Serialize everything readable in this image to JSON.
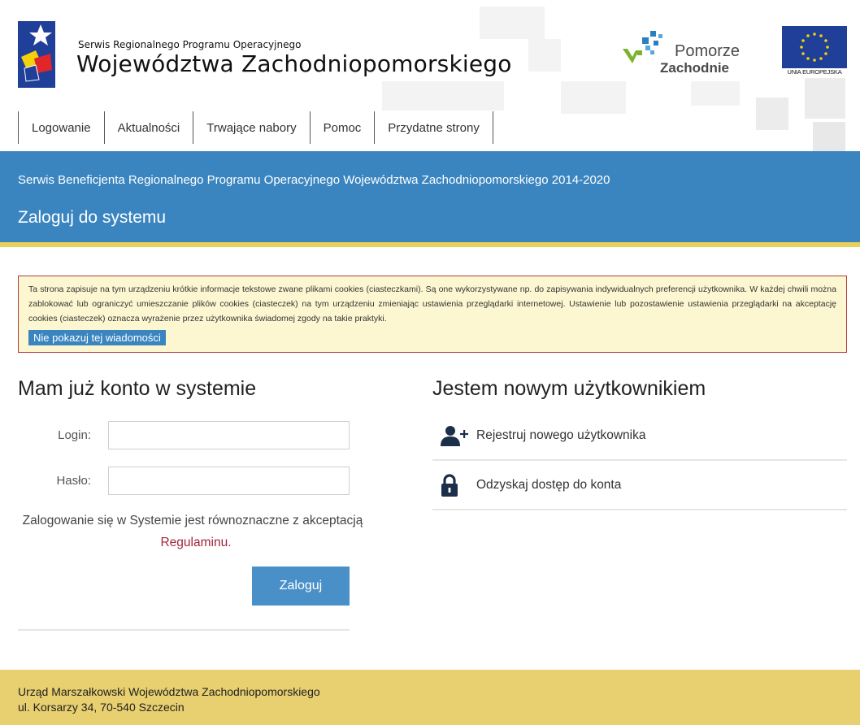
{
  "header": {
    "brand_small": "Serwis Regionalnego Programu Operacyjnego",
    "brand_big": "Województwa Zachodniopomorskiego",
    "pomorze_line1": "Pomorze",
    "pomorze_line2": "Zachodnie",
    "eu_label": "UNIA EUROPEJSKA"
  },
  "nav": {
    "items": [
      {
        "label": "Logowanie"
      },
      {
        "label": "Aktualności"
      },
      {
        "label": "Trwające nabory"
      },
      {
        "label": "Pomoc"
      },
      {
        "label": "Przydatne strony"
      }
    ]
  },
  "band": {
    "subtitle": "Serwis Beneficjenta Regionalnego Programu Operacyjnego Województwa Zachodniopomorskiego 2014-2020",
    "title": "Zaloguj do systemu"
  },
  "cookie": {
    "text": "Ta strona zapisuje na tym urządzeniu krótkie informacje tekstowe zwane plikami cookies (ciasteczkami). Są one wykorzystywane np. do zapisywania indywidualnych preferencji użytkownika. W każdej chwili można zablokować lub ograniczyć umieszczanie plików cookies (ciasteczek) na tym urządzeniu zmieniając ustawienia przeglądarki internetowej. Ustawienie lub pozostawienie ustawienia przeglądarki na akceptację cookies (ciasteczek) oznacza wyrażenie przez użytkownika świadomej zgody na takie praktyki.",
    "dismiss_label": "Nie pokazuj tej wiadomości"
  },
  "login": {
    "title": "Mam już konto w systemie",
    "login_label": "Login:",
    "login_value": "",
    "password_label": "Hasło:",
    "password_value": "",
    "terms_text": "Zalogowanie się w Systemie jest równoznaczne z akceptacją",
    "terms_link": "Regulaminu",
    "terms_end": ".",
    "submit_label": "Zaloguj"
  },
  "new_user": {
    "title": "Jestem nowym użytkownikiem",
    "register_label": "Rejestruj nowego użytkownika",
    "recover_label": "Odzyskaj dostęp do konta"
  },
  "footer": {
    "line1": "Urząd Marszałkowski Województwa Zachodniopomorskiego",
    "line2": "ul. Korsarzy 34, 70-540 Szczecin"
  },
  "colors": {
    "band_blue": "#3a85c0",
    "accent_yellow": "#e8cf6f",
    "link_red": "#a3243b",
    "cookie_bg": "#fdf7d1"
  }
}
